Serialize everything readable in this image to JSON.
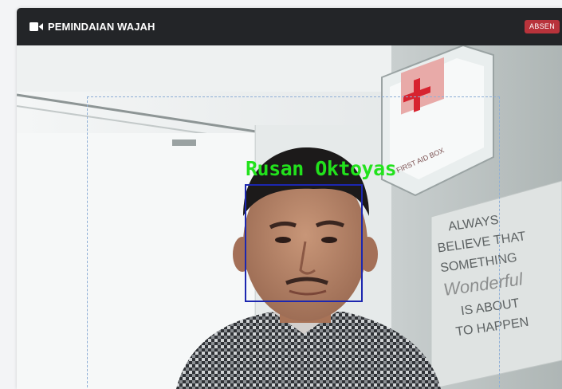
{
  "header": {
    "title": "PEMINDAIAN WAJAH",
    "icon": "video-camera-icon",
    "status_badge": "ABSEN"
  },
  "camera": {
    "detected_name": "Rusan Oktoyas",
    "poster_text": [
      "ALWAYS",
      "BELIEVE THAT",
      "SOMETHING",
      "Wonderful",
      "IS ABOUT",
      "TO HAPPEN"
    ],
    "first_aid_box_label": "FIRST AID BOX"
  },
  "colors": {
    "header_bg": "#232528",
    "badge_bg": "#b8333b",
    "label_color": "#22e21c",
    "box_color": "#1c27b0",
    "guide_color": "#8eaed6"
  }
}
